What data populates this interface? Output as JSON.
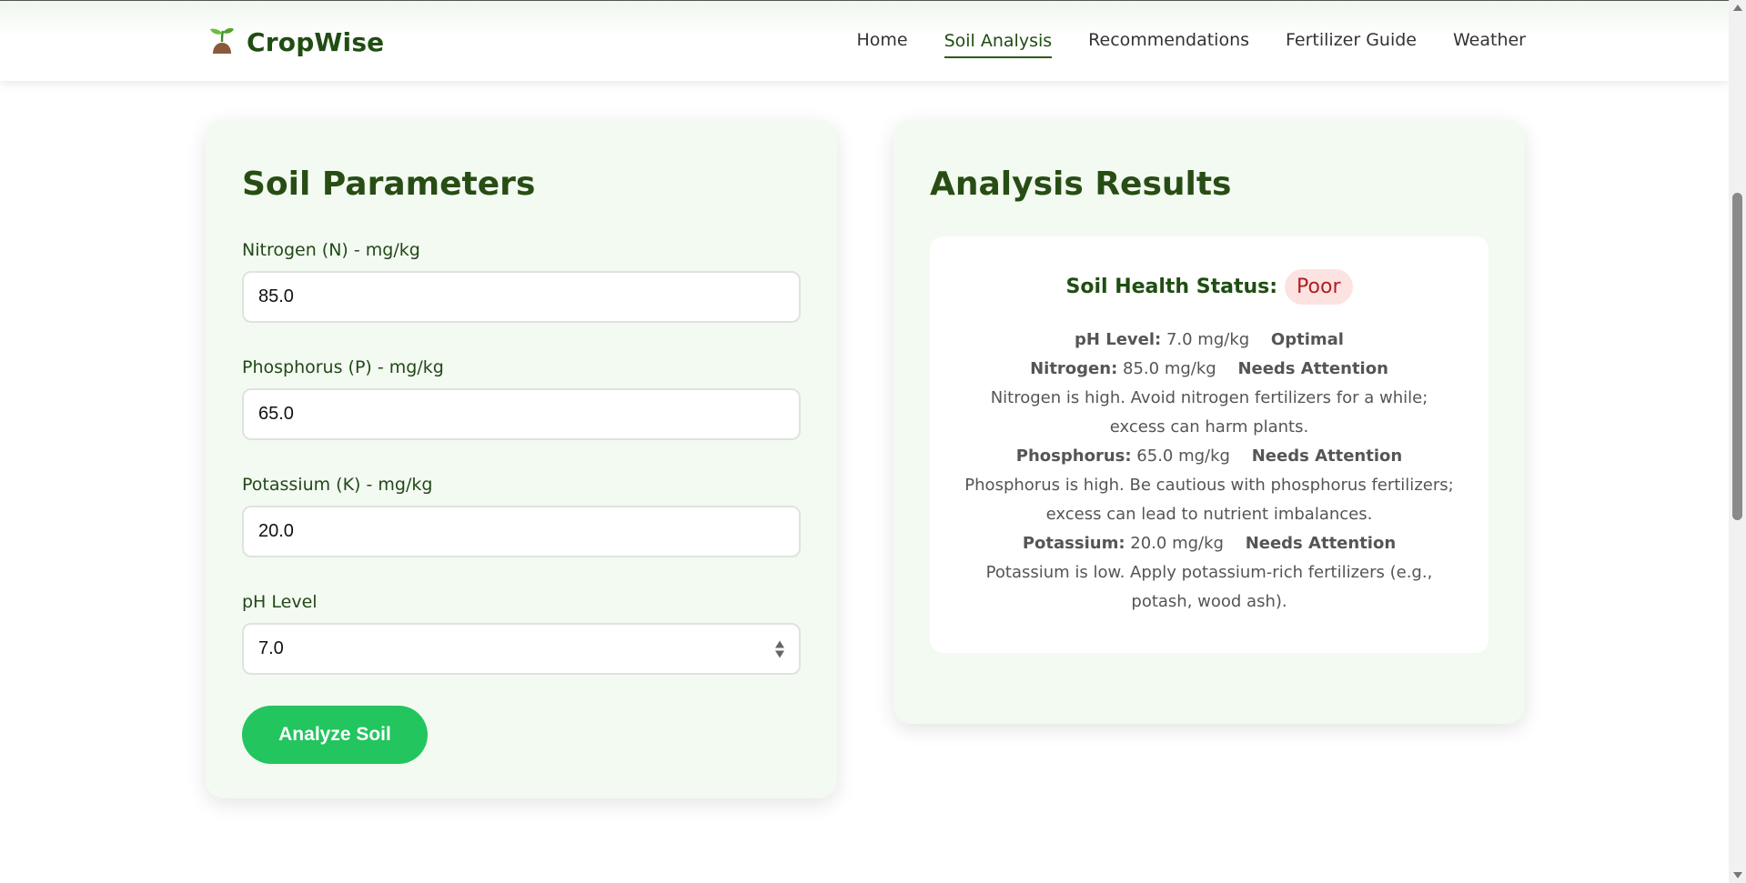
{
  "brand": {
    "name": "CropWise",
    "icon": "seedling-icon"
  },
  "nav": {
    "items": [
      {
        "label": "Home",
        "active": false
      },
      {
        "label": "Soil Analysis",
        "active": true
      },
      {
        "label": "Recommendations",
        "active": false
      },
      {
        "label": "Fertilizer Guide",
        "active": false
      },
      {
        "label": "Weather",
        "active": false
      }
    ]
  },
  "params": {
    "title": "Soil Parameters",
    "fields": [
      {
        "label": "Nitrogen (N) - mg/kg",
        "value": "85.0"
      },
      {
        "label": "Phosphorus (P) - mg/kg",
        "value": "65.0"
      },
      {
        "label": "Potassium (K) - mg/kg",
        "value": "20.0"
      },
      {
        "label": "pH Level",
        "value": "7.0"
      }
    ],
    "button": "Analyze Soil"
  },
  "results": {
    "title": "Analysis Results",
    "status_label": "Soil Health Status:",
    "status": "Poor",
    "ph": {
      "label": "pH Level:",
      "value": "7.0 mg/kg",
      "status": "Optimal"
    },
    "nitrogen": {
      "label": "Nitrogen:",
      "value": "85.0 mg/kg",
      "status": "Needs Attention",
      "note": "Nitrogen is high. Avoid nitrogen fertilizers for a while; excess can harm plants."
    },
    "phosphorus": {
      "label": "Phosphorus:",
      "value": "65.0 mg/kg",
      "status": "Needs Attention",
      "note": "Phosphorus is high. Be cautious with phosphorus fertilizers; excess can lead to nutrient imbalances."
    },
    "potassium": {
      "label": "Potassium:",
      "value": "20.0 mg/kg",
      "status": "Needs Attention",
      "note": "Potassium is low. Apply potassium-rich fertilizers (e.g., potash, wood ash)."
    }
  },
  "colors": {
    "brand_green": "#1f4d12",
    "accent_green": "#22c55e",
    "card_bg": "#f3faf1",
    "poor_badge_bg": "#fde2e2",
    "poor_badge_text": "#b02020"
  }
}
